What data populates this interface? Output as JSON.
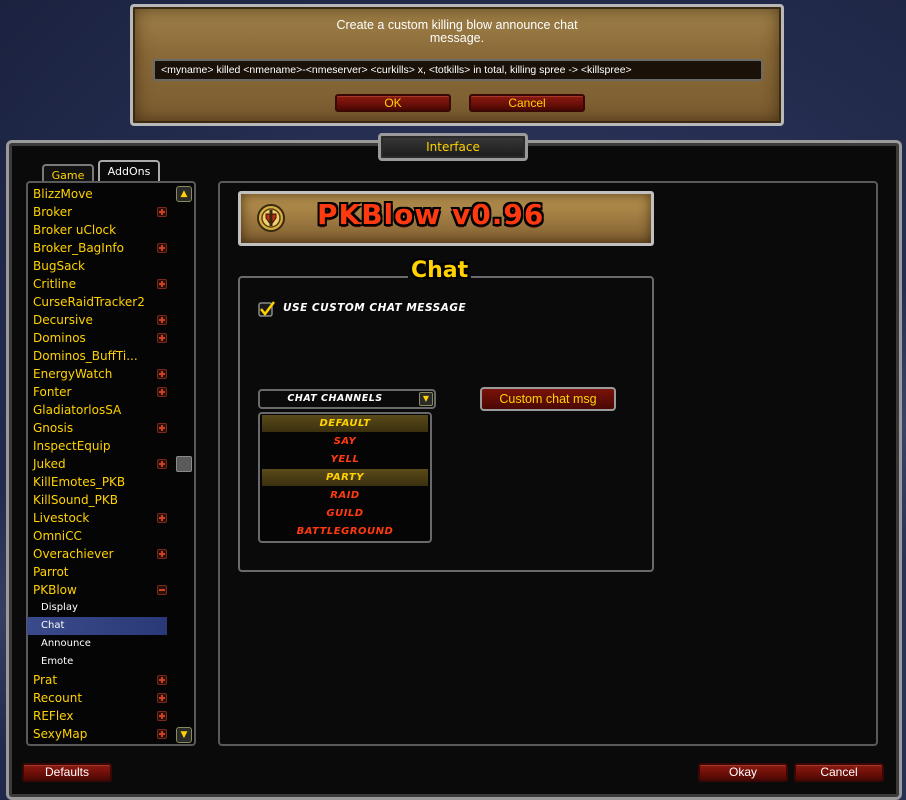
{
  "popup": {
    "message_line1": "Create a custom killing blow announce chat",
    "message_line2": "message.",
    "input_value": "<myname> killed <nmename>-<nmeserver> <curkills> x,  <totkills> in total, killing spree -> <killspree>",
    "ok_label": "OK",
    "cancel_label": "Cancel"
  },
  "window": {
    "title": "Interface",
    "tabs": [
      {
        "label": "Game"
      },
      {
        "label": "AddOns"
      }
    ]
  },
  "addon_list": {
    "items": [
      {
        "label": "BlizzMove",
        "expand": ""
      },
      {
        "label": "Broker",
        "expand": "plus"
      },
      {
        "label": "Broker uClock",
        "expand": ""
      },
      {
        "label": "Broker_BagInfo",
        "expand": "plus"
      },
      {
        "label": "BugSack",
        "expand": ""
      },
      {
        "label": "Critline",
        "expand": "plus"
      },
      {
        "label": "CurseRaidTracker2",
        "expand": ""
      },
      {
        "label": "Decursive",
        "expand": "plus"
      },
      {
        "label": "Dominos",
        "expand": "plus"
      },
      {
        "label": "Dominos_BuffTi...",
        "expand": ""
      },
      {
        "label": "EnergyWatch",
        "expand": "plus"
      },
      {
        "label": "Fonter",
        "expand": "plus"
      },
      {
        "label": "GladiatorlosSA",
        "expand": ""
      },
      {
        "label": "Gnosis",
        "expand": "plus"
      },
      {
        "label": "InspectEquip",
        "expand": ""
      },
      {
        "label": "Juked",
        "expand": "plus"
      },
      {
        "label": "KillEmotes_PKB",
        "expand": ""
      },
      {
        "label": "KillSound_PKB",
        "expand": ""
      },
      {
        "label": "Livestock",
        "expand": "plus"
      },
      {
        "label": "OmniCC",
        "expand": ""
      },
      {
        "label": "Overachiever",
        "expand": "plus"
      },
      {
        "label": "Parrot",
        "expand": ""
      },
      {
        "label": "PKBlow",
        "expand": "minus"
      },
      {
        "label": "Display",
        "expand": "",
        "sub": true
      },
      {
        "label": "Chat",
        "expand": "",
        "sub": true,
        "selected": true
      },
      {
        "label": "Announce",
        "expand": "",
        "sub": true
      },
      {
        "label": "Emote",
        "expand": "",
        "sub": true
      },
      {
        "label": "Prat",
        "expand": "plus"
      },
      {
        "label": "Recount",
        "expand": "plus"
      },
      {
        "label": "REFlex",
        "expand": "plus"
      },
      {
        "label": "SexyMap",
        "expand": "plus"
      }
    ]
  },
  "addon_panel": {
    "banner_title": "PKBlow  v0.96",
    "section_title": "Chat",
    "checkbox_label": "USE CUSTOM CHAT MESSAGE",
    "checkbox_checked": true,
    "dropdown_label": "CHAT CHANNELS",
    "channel_options": [
      {
        "label": "DEFAULT",
        "highlighted": true
      },
      {
        "label": "SAY",
        "highlighted": false
      },
      {
        "label": "YELL",
        "highlighted": false
      },
      {
        "label": "PARTY",
        "highlighted": true
      },
      {
        "label": "RAID",
        "highlighted": false
      },
      {
        "label": "GUILD",
        "highlighted": false
      },
      {
        "label": "BATTLEGROUND",
        "highlighted": false
      }
    ],
    "custom_button_label": "Custom chat msg"
  },
  "footer": {
    "defaults_label": "Defaults",
    "okay_label": "Okay",
    "cancel_label": "Cancel"
  },
  "colors": {
    "gold_text": "#ffd200",
    "red_text": "#ff3a10",
    "selection": "#2a3a78"
  }
}
